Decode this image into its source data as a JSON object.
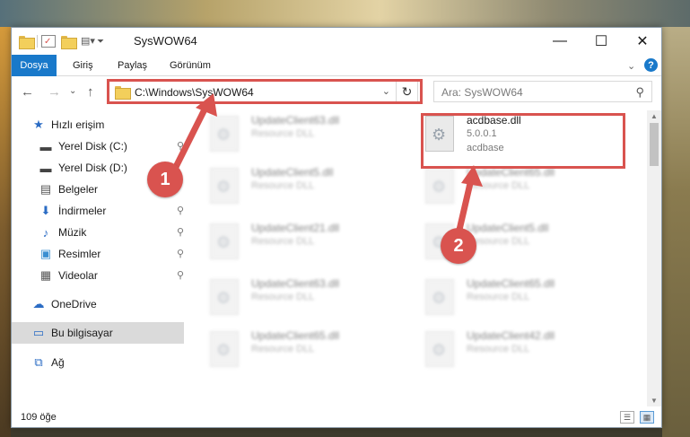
{
  "window": {
    "title": "SysWOW64",
    "controls": {
      "minimize": "—",
      "maximize": "☐",
      "close": "✕"
    }
  },
  "ribbon": {
    "file_tab": "Dosya",
    "tabs": [
      "Giriş",
      "Paylaş",
      "Görünüm"
    ],
    "expand_glyph": "⌄",
    "help_glyph": "?"
  },
  "nav": {
    "back": "←",
    "forward": "→",
    "dropdown": "⌄",
    "up": "↑",
    "address": "C:\\Windows\\SysWOW64",
    "address_dropdown": "⌄",
    "refresh": "↻",
    "search_placeholder": "Ara: SysWOW64",
    "search_glyph": "⚲"
  },
  "sidebar": {
    "items": [
      {
        "label": "Hızlı erişim",
        "icon": "star-icon",
        "glyph": "★",
        "color": "#2b6cc4"
      },
      {
        "label": "Yerel Disk (C:)",
        "icon": "disk-icon",
        "glyph": "▬",
        "color": "#444",
        "pinned": true
      },
      {
        "label": "Yerel Disk (D:)",
        "icon": "disk-icon",
        "glyph": "▬",
        "color": "#444",
        "pinned": true
      },
      {
        "label": "Belgeler",
        "icon": "document-icon",
        "glyph": "▤",
        "color": "#555",
        "pinned": true
      },
      {
        "label": "İndirmeler",
        "icon": "download-icon",
        "glyph": "⬇",
        "color": "#2b6cc4",
        "pinned": true
      },
      {
        "label": "Müzik",
        "icon": "music-icon",
        "glyph": "♪",
        "color": "#2b6cc4",
        "pinned": true
      },
      {
        "label": "Resimler",
        "icon": "pictures-icon",
        "glyph": "▣",
        "color": "#3a8fd1",
        "pinned": true
      },
      {
        "label": "Videolar",
        "icon": "video-icon",
        "glyph": "▦",
        "color": "#555",
        "pinned": true
      },
      {
        "label": "OneDrive",
        "icon": "cloud-icon",
        "glyph": "☁",
        "color": "#2b6cc4"
      },
      {
        "label": "Bu bilgisayar",
        "icon": "computer-icon",
        "glyph": "▭",
        "color": "#2b6cc4",
        "selected": true
      },
      {
        "label": "Ağ",
        "icon": "network-icon",
        "glyph": "⧉",
        "color": "#2b6cc4"
      }
    ],
    "pin_glyph": "📌"
  },
  "files": [
    {
      "name": "UpdateClient63.dll",
      "sub": "Resource DLL",
      "blurred": true
    },
    {
      "name": "acdbase.dll",
      "version": "5.0.0.1",
      "sub": "acdbase",
      "blurred": false
    },
    {
      "name": "UpdateClient5.dll",
      "sub": "Resource DLL",
      "blurred": true
    },
    {
      "name": "UpdateClient65.dll",
      "sub": "Resource DLL",
      "blurred": true
    },
    {
      "name": "UpdateClient21.dll",
      "sub": "Resource DLL",
      "blurred": true
    },
    {
      "name": "UpdateClient5.dll",
      "sub": "Resource DLL",
      "blurred": true
    },
    {
      "name": "UpdateClient63.dll",
      "sub": "Resource DLL",
      "blurred": true
    },
    {
      "name": "UpdateClient65.dll",
      "sub": "Resource DLL",
      "blurred": true
    },
    {
      "name": "UpdateClient65.dll",
      "sub": "Resource DLL",
      "blurred": true
    },
    {
      "name": "UpdateClient42.dll",
      "sub": "Resource DLL",
      "blurred": true
    }
  ],
  "status": {
    "count": "109 öğe"
  },
  "callouts": {
    "one": "1",
    "two": "2"
  },
  "colors": {
    "accent": "#1979ca",
    "highlight": "#d9534f"
  }
}
